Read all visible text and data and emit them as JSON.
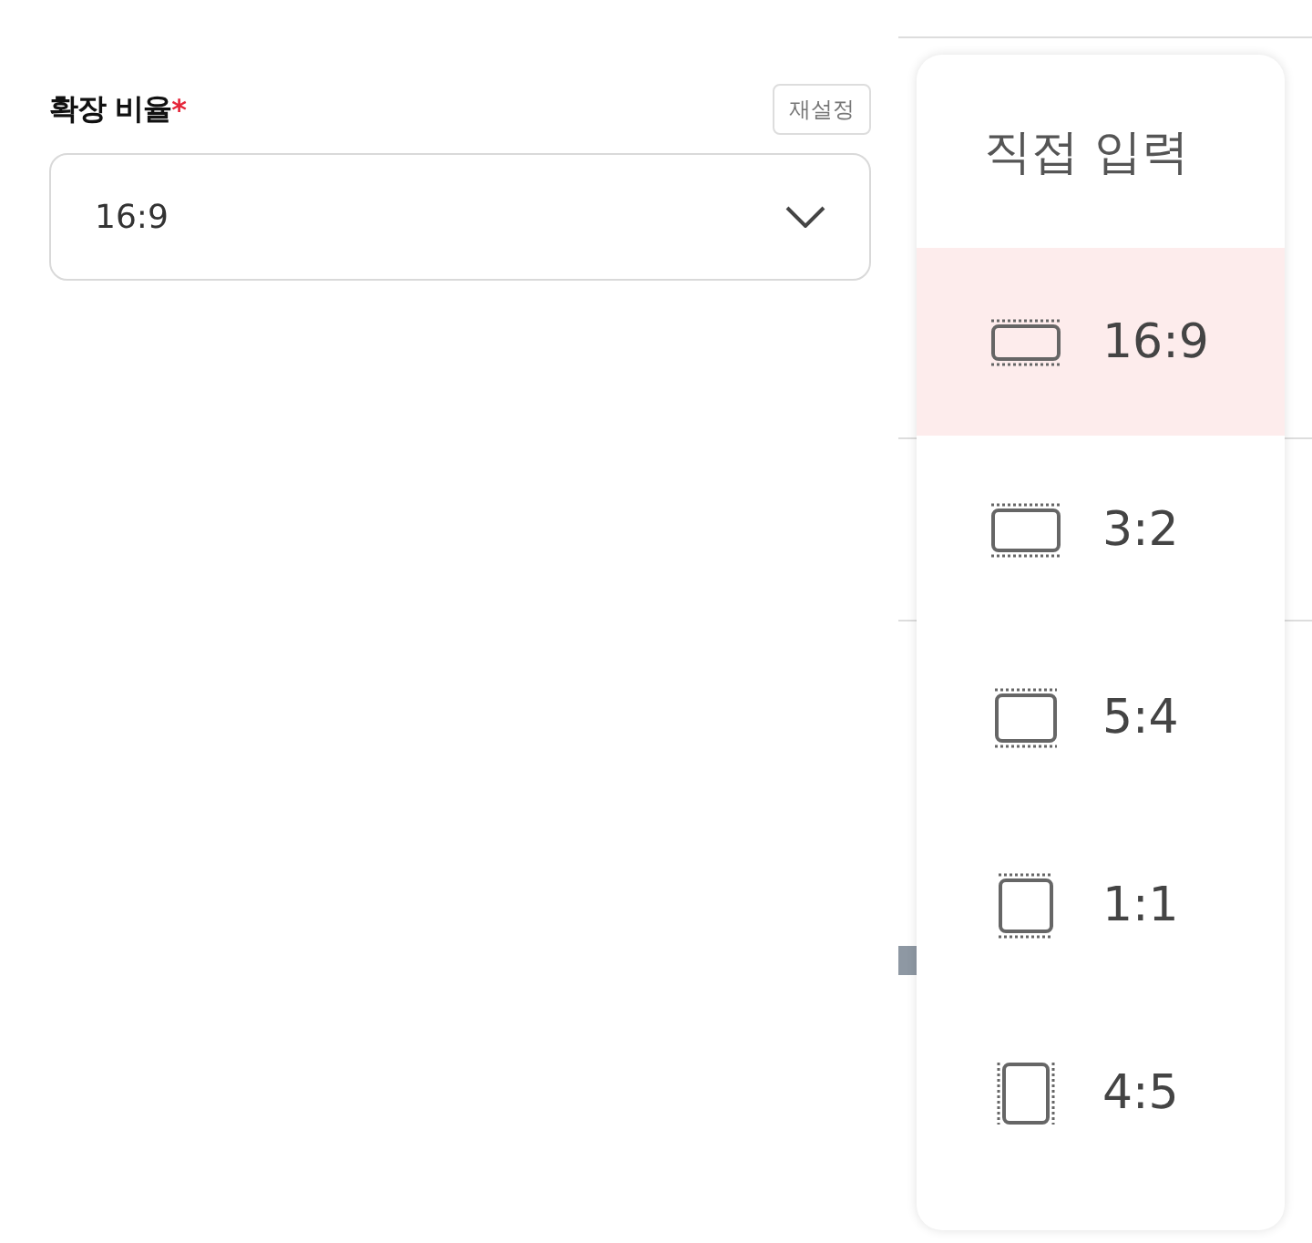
{
  "field": {
    "label": "확장 비율",
    "required_mark": "*",
    "reset_button": "재설정",
    "value": "16:9"
  },
  "menu": {
    "header": "직접 입력",
    "options": [
      {
        "label": "16:9",
        "kind": "wide",
        "selected": true
      },
      {
        "label": "3:2",
        "kind": "landscape",
        "selected": false
      },
      {
        "label": "5:4",
        "kind": "standard",
        "selected": false
      },
      {
        "label": "1:1",
        "kind": "square",
        "selected": false
      },
      {
        "label": "4:5",
        "kind": "portrait",
        "selected": false
      }
    ]
  }
}
